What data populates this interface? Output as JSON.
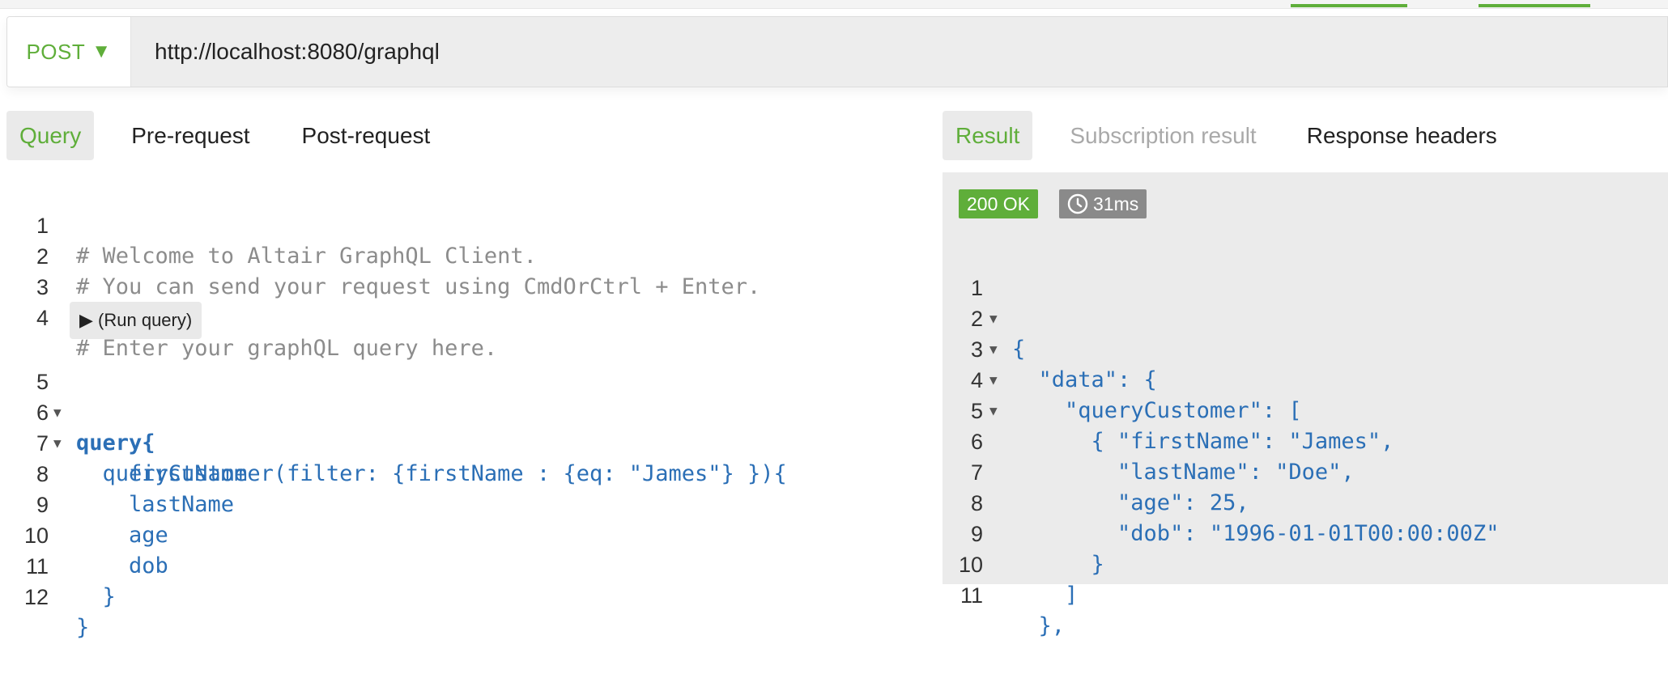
{
  "request": {
    "method": "POST",
    "url": "http://localhost:8080/graphql"
  },
  "query_tabs": [
    {
      "label": "Query",
      "active": true
    },
    {
      "label": "Pre-request",
      "active": false
    },
    {
      "label": "Post-request",
      "active": false
    }
  ],
  "result_tabs": [
    {
      "label": "Result",
      "active": true
    },
    {
      "label": "Subscription result",
      "active": false
    },
    {
      "label": "Response headers",
      "active": false
    }
  ],
  "editor": {
    "run_query_label": "▶ (Run query)",
    "lines": [
      {
        "n": "1",
        "text": "# Welcome to Altair GraphQL Client."
      },
      {
        "n": "2",
        "text": "# You can send your request using CmdOrCtrl + Enter."
      },
      {
        "n": "3",
        "text": ""
      },
      {
        "n": "4",
        "text": "# Enter your graphQL query here."
      },
      {
        "n": "5",
        "text": "query{"
      },
      {
        "n": "6",
        "text": "  queryCustomer(filter: {firstName : {eq: \"James\"} }){"
      },
      {
        "n": "7",
        "text": "    firstName"
      },
      {
        "n": "8",
        "text": "    lastName"
      },
      {
        "n": "9",
        "text": "    age"
      },
      {
        "n": "10",
        "text": "    dob"
      },
      {
        "n": "11",
        "text": "  }"
      },
      {
        "n": "12",
        "text": "}"
      }
    ]
  },
  "response": {
    "status": "200 OK",
    "time": "31ms",
    "lines": [
      {
        "n": "1",
        "text": "{"
      },
      {
        "n": "2",
        "text": "  \"data\": {"
      },
      {
        "n": "3",
        "text": "    \"queryCustomer\": ["
      },
      {
        "n": "4",
        "text": "      {"
      },
      {
        "n": "5",
        "text": "        \"firstName\": \"James\","
      },
      {
        "n": "6",
        "text": "        \"lastName\": \"Doe\","
      },
      {
        "n": "7",
        "text": "        \"age\": 25,"
      },
      {
        "n": "8",
        "text": "        \"dob\": \"1996-01-01T00:00:00Z\""
      },
      {
        "n": "9",
        "text": "      }"
      },
      {
        "n": "10",
        "text": "    ]"
      },
      {
        "n": "11",
        "text": "  },"
      }
    ]
  },
  "colors": {
    "accent_green": "#5fae3a",
    "code_blue": "#2b6fb6",
    "string_orange": "#e59c3a",
    "comment_gray": "#8c8c8c"
  },
  "icons": {
    "method_dropdown": "triangle-down-icon",
    "fold": "fold-caret-icon",
    "time": "clock-icon"
  }
}
